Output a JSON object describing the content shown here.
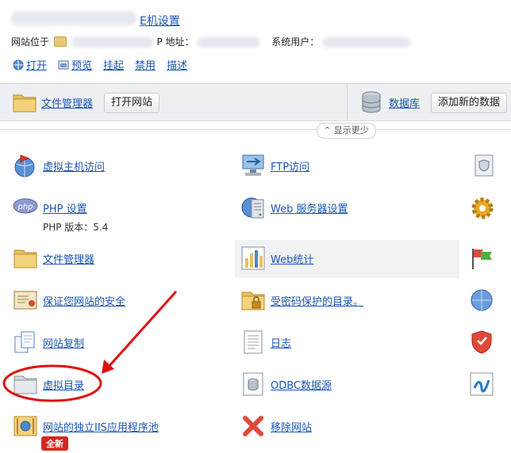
{
  "header": {
    "title_link": "E机设置",
    "site_location_label": "网站位于",
    "ip_label": "P 地址：",
    "system_user_label": "系统用户："
  },
  "actions": [
    {
      "label": "打开"
    },
    {
      "label": "预览"
    },
    {
      "label": "挂起"
    },
    {
      "label": "禁用"
    },
    {
      "label": "描述"
    }
  ],
  "toolbar": {
    "file_manager": "文件管理器",
    "open_site": "打开网站",
    "database": "数据库",
    "add_database": "添加新的数据"
  },
  "show_less": "⌃ 显示更少",
  "col1": [
    {
      "label": "虚拟主机访问",
      "icon": "globe-arrow-icon"
    },
    {
      "label": "PHP 设置",
      "sub": "PHP 版本：5.4",
      "icon": "php-icon"
    },
    {
      "label": "文件管理器",
      "icon": "folder-icon"
    },
    {
      "label": "保证您网站的安全",
      "icon": "certificate-icon"
    },
    {
      "label": "网站复制",
      "icon": "copy-icon"
    },
    {
      "label": "虚拟目录",
      "icon": "folder-grey-icon"
    },
    {
      "label": "网站的独立IIS应用程序池",
      "icon": "app-pool-icon",
      "badge": "全新"
    }
  ],
  "col2": [
    {
      "label": "FTP访问",
      "icon": "ftp-icon"
    },
    {
      "label": "Web 服务器设置",
      "icon": "web-server-icon"
    },
    {
      "label": "Web统计",
      "icon": "stats-icon"
    },
    {
      "label": "受密码保护的目录。",
      "icon": "folder-lock-icon"
    },
    {
      "label": "日志",
      "icon": "log-icon"
    },
    {
      "label": "ODBC数据源",
      "icon": "odbc-icon"
    },
    {
      "label": "移除网站",
      "icon": "remove-icon"
    }
  ],
  "colors": {
    "link": "#1a55b5",
    "annotation": "#e01010",
    "badge": "#d6261e"
  }
}
